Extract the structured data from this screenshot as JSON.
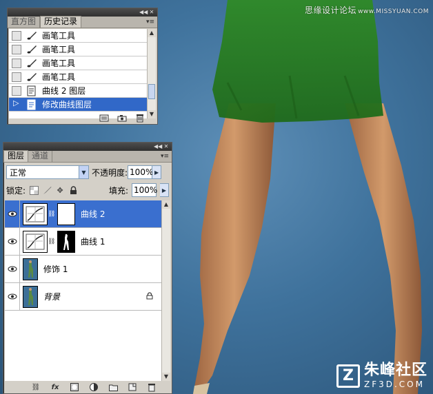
{
  "colors": {
    "selection": "#3168c8",
    "panel_bg": "#d4d0c8",
    "background_blue": "#3f729c",
    "dress_green": "#2f7d24",
    "skin": "#c58a5c"
  },
  "watermark": {
    "top_cn": "思缘设计论坛",
    "top_en": "www.MISSYUAN.COM",
    "bottom_logo_icon": "z-logo-icon",
    "bottom_cn": "朱峰社区",
    "bottom_en": "ZF3D.COM"
  },
  "history_panel": {
    "tabs": [
      "直方图",
      "历史记录"
    ],
    "active_tab": 1,
    "items": [
      {
        "label": "画笔工具",
        "icon": "brush-icon",
        "selected": false
      },
      {
        "label": "画笔工具",
        "icon": "brush-icon",
        "selected": false
      },
      {
        "label": "画笔工具",
        "icon": "brush-icon",
        "selected": false
      },
      {
        "label": "画笔工具",
        "icon": "brush-icon",
        "selected": false
      },
      {
        "label": "曲线 2 图层",
        "icon": "document-icon",
        "selected": false
      },
      {
        "label": "修改曲线图层",
        "icon": "document-icon",
        "selected": true
      }
    ],
    "footer_icons": [
      "new-document-from-state-icon",
      "new-snapshot-icon",
      "trash-icon"
    ]
  },
  "layers_panel": {
    "tabs": [
      "图层",
      "通道"
    ],
    "active_tab": 0,
    "blend_mode": "正常",
    "opacity_label": "不透明度:",
    "opacity_value": "100%",
    "lock_label": "锁定:",
    "fill_label": "填充:",
    "fill_value": "100%",
    "layers": [
      {
        "name": "曲线 2",
        "type": "adjustment",
        "mask": "white",
        "selected": true,
        "locked": false
      },
      {
        "name": "曲线 1",
        "type": "adjustment",
        "mask": "dark",
        "selected": false,
        "locked": false
      },
      {
        "name": "修饰 1",
        "type": "image",
        "selected": false,
        "locked": false
      },
      {
        "name": "背景",
        "type": "image",
        "selected": false,
        "locked": true
      }
    ]
  }
}
